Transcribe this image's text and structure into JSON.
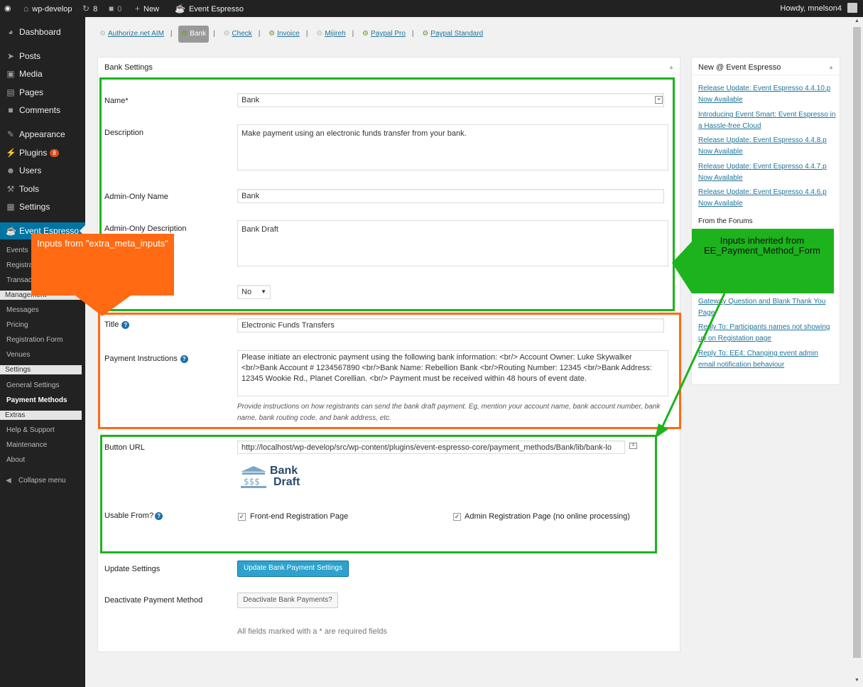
{
  "adminbar": {
    "site": "wp-develop",
    "updates": "8",
    "comments": "0",
    "new": "New",
    "plugin": "Event Espresso",
    "howdy": "Howdy, mnelson4"
  },
  "sidebar": {
    "items": [
      {
        "label": "Dashboard"
      },
      {
        "label": "Posts"
      },
      {
        "label": "Media"
      },
      {
        "label": "Pages"
      },
      {
        "label": "Comments"
      },
      {
        "label": "Appearance"
      },
      {
        "label": "Plugins",
        "badge": "8"
      },
      {
        "label": "Users"
      },
      {
        "label": "Tools"
      },
      {
        "label": "Settings"
      },
      {
        "label": "Event Espresso"
      }
    ],
    "sub": {
      "events": "Events",
      "registrations": "Registrations",
      "transactions": "Transactions",
      "management": "Management",
      "messages": "Messages",
      "pricing": "Pricing",
      "registration_form": "Registration Form",
      "venues": "Venues",
      "settings": "Settings",
      "general_settings": "General Settings",
      "payment_methods": "Payment Methods",
      "extras": "Extras",
      "help": "Help & Support",
      "maintenance": "Maintenance",
      "about": "About",
      "collapse": "Collapse menu"
    }
  },
  "tabs": [
    "Authorize.net AIM",
    "Bank",
    "Check",
    "Invoice",
    "Mijireh",
    "Paypal Pro",
    "Paypal Standard"
  ],
  "panel": {
    "title": "Bank Settings",
    "name_label": "Name*",
    "name_value": "Bank",
    "description_label": "Description",
    "description_value": "Make payment using an electronic funds transfer from your bank.",
    "admin_name_label": "Admin-Only Name",
    "admin_name_value": "Bank",
    "admin_desc_label": "Admin-Only Description",
    "admin_desc_value": "Bank Draft",
    "select_value": "No",
    "title_label": "Title",
    "title_value": "Electronic Funds Transfers",
    "instructions_label": "Payment Instructions",
    "instructions_value": "Please initiate an electronic payment using the following bank information: <br/> Account Owner: Luke Skywalker <br/>Bank Account # 1234567890 <br/>Bank Name: Rebellion Bank <br/>Routing Number: 12345 <br/>Bank Address: 12345 Wookie Rd., Planet Corellian. <br/>  Payment must be received within 48 hours of event date.",
    "instructions_note": "Provide instructions on how registrants can send the bank draft payment. Eg, mention your account name, bank account number, bank name, bank routing code, and bank address, etc.",
    "button_url_label": "Button URL",
    "button_url_value": "http://localhost/wp-develop/src/wp-content/plugins/event-espresso-core/payment_methods/Bank/lib/bank-lo",
    "logo_line1": "Bank",
    "logo_line2": "Draft",
    "usable_label": "Usable From?",
    "usable_front": "Front-end Registration Page",
    "usable_admin": "Admin Registration Page (no online processing)",
    "update_label": "Update Settings",
    "update_button": "Update Bank Payment Settings",
    "deactivate_label": "Deactivate Payment Method",
    "deactivate_button": "Deactivate Bank Payments?",
    "required_note": "All fields marked with a * are required fields"
  },
  "widget": {
    "title": "New @ Event Espresso",
    "links": [
      "Release Update: Event Espresso 4.4.10.p Now Available",
      "Introducing Event Smart: Event Espresso in a Hassle-free Cloud",
      "Release Update: Event Espresso 4.4.8.p Now Available",
      "Release Update: Event Espresso 4.4.7.p Now Available",
      "Release Update: Event Espresso 4.4.6.p Now Available"
    ],
    "forums_title": "From the Forums",
    "forum_links": [
      "Gateway Question and Blank Thank You Page",
      "Reply To: Participants names not showing up on Registation page",
      "Reply To: EE4: Changing event admin email notification behaviour"
    ]
  },
  "annotations": {
    "orange": "Inputs from \"extra_meta_inputs\"",
    "green": "Inputs inherited from EE_Payment_Method_Form",
    "orange_color": "#ff6a13",
    "green_color": "#1db31d"
  }
}
